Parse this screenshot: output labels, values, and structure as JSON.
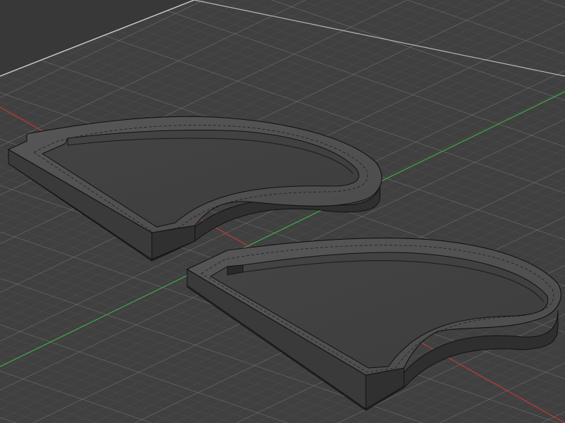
{
  "viewport": {
    "view": "perspective",
    "background_color": "#3b3b3b",
    "grid": {
      "visible": true,
      "minor_color": "#4f4f4f",
      "major_color": "#7d7d7d",
      "border_color": "#cfcfcf"
    },
    "axes": {
      "x_axis_color": "#c13a3a",
      "y_axis_color": "#3fae4a"
    },
    "objects": [
      {
        "id": "part-upper",
        "type": "extruded-fin-tray",
        "fill_color": "#505050",
        "edge_color": "#111111"
      },
      {
        "id": "part-lower",
        "type": "extruded-fin-tray",
        "fill_color": "#505050",
        "edge_color": "#111111"
      }
    ]
  }
}
